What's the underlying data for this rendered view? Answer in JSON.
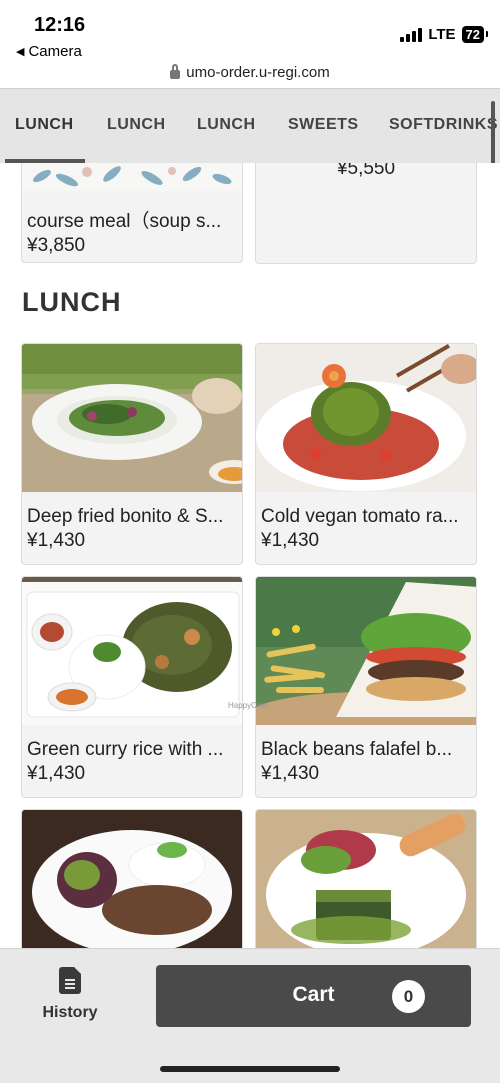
{
  "status_bar": {
    "time": "12:16",
    "back_app": "Camera",
    "network": "LTE",
    "battery": "72"
  },
  "url_bar": {
    "url": "umo-order.u-regi.com"
  },
  "tabs": [
    {
      "label": "LUNCH",
      "active": true
    },
    {
      "label": "LUNCH",
      "active": false
    },
    {
      "label": "LUNCH",
      "active": false
    },
    {
      "label": "SWEETS",
      "active": false
    },
    {
      "label": "SOFTDRINKS",
      "active": false
    }
  ],
  "top_cards": [
    {
      "name": "course meal（soup s...",
      "price": "¥3,850"
    },
    {
      "name": "",
      "price": "¥5,550"
    }
  ],
  "section": {
    "title": "LUNCH"
  },
  "menu_items": [
    {
      "name": "Deep fried bonito & S...",
      "price": "¥1,430"
    },
    {
      "name": "Cold vegan tomato ra...",
      "price": "¥1,430"
    },
    {
      "name": "Green curry rice with ...",
      "price": "¥1,430"
    },
    {
      "name": "Black beans falafel b...",
      "price": "¥1,430"
    }
  ],
  "watermark": "HappyCow",
  "bottom_bar": {
    "history_label": "History",
    "cart_label": "Cart",
    "cart_count": "0"
  }
}
